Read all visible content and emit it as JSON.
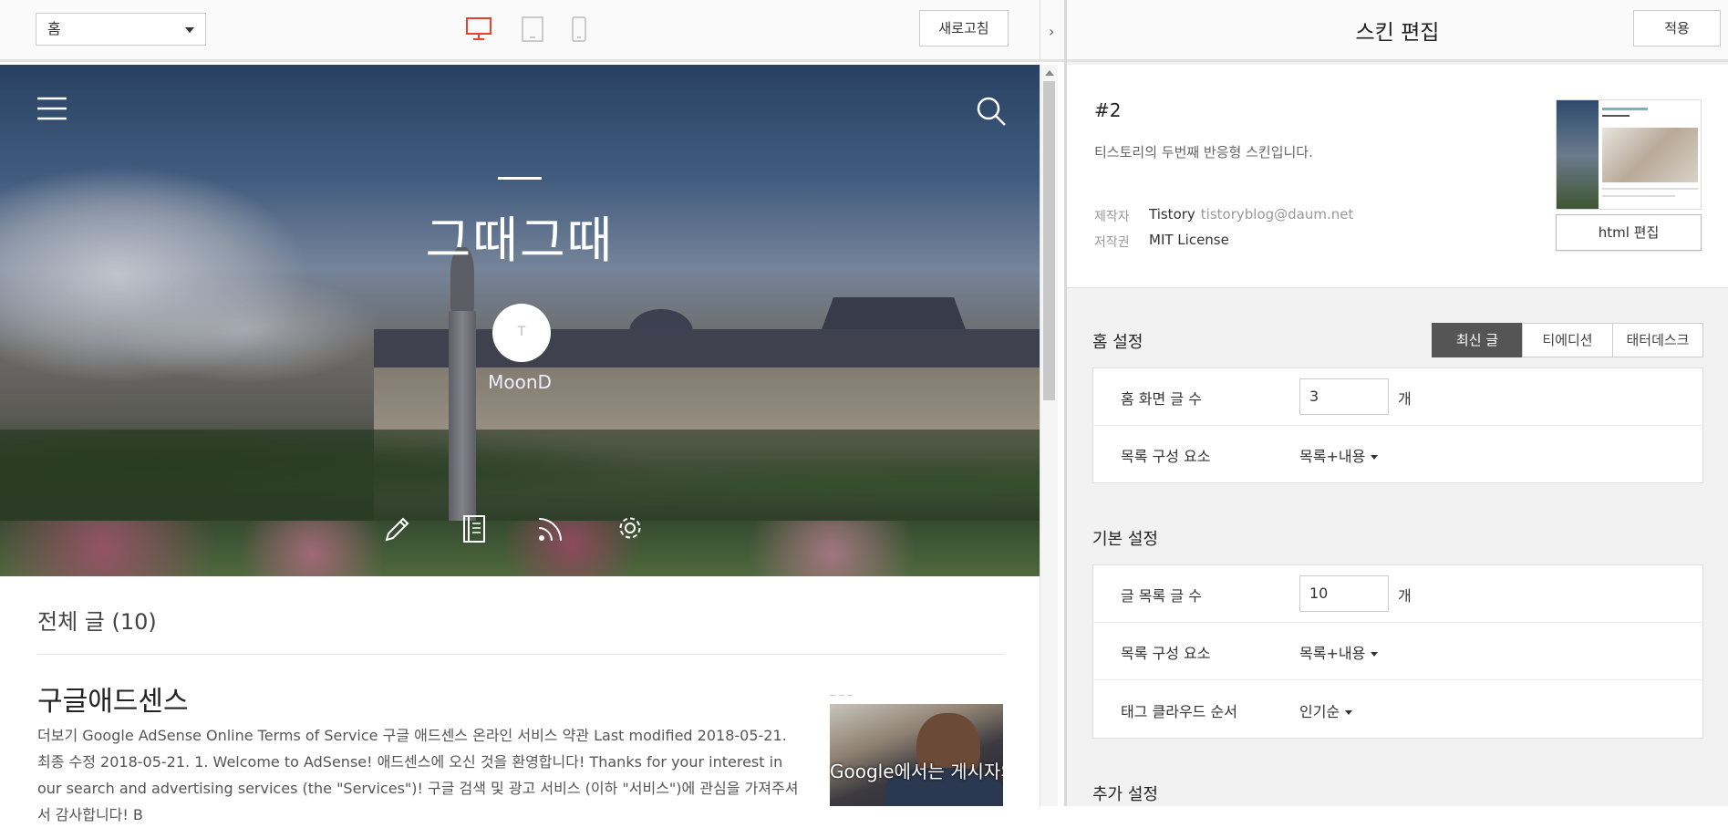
{
  "toolbar": {
    "page_select_value": "홈",
    "refresh_label": "새로고침",
    "accent_color": "#e8412c"
  },
  "preview": {
    "blog_title": "그때그때",
    "profile_name": "MoonD",
    "profile_initial": "T",
    "list_title": "전체 글 (10)",
    "post": {
      "title": "구글애드센스",
      "excerpt": "더보기 Google AdSense Online Terms of Service 구글 애드센스 온라인 서비스 약관 Last modified 2018-05-21. 최종 수정 2018-05-21. 1. Welcome to AdSense! 애드센스에 오신 것을 환영합니다! Thanks for your interest in our search and advertising services (the \"Services\")! 구글 검색 및 광고 서비스 (이하 \"서비스\")에 관심을 가져주셔서 감사합니다! B",
      "thumb_text": "Google에서는 게시자의 콘텐츠를 소중하게"
    },
    "icons": [
      "menu-icon",
      "search-icon",
      "write-icon",
      "guestbook-icon",
      "rss-icon",
      "settings-icon"
    ]
  },
  "panel": {
    "title": "스킨 편집",
    "apply_label": "적용",
    "skin": {
      "name": "#2",
      "description": "티스토리의 두번째 반응형 스킨입니다.",
      "author_label": "제작자",
      "author": "Tistory",
      "author_email": "tistoryblog@daum.net",
      "license_label": "저작권",
      "license": "MIT License",
      "html_edit_label": "html 편집"
    },
    "home": {
      "title": "홈 설정",
      "tabs": [
        "최신 글",
        "티에디션",
        "태터데스크"
      ],
      "active_tab": "최신 글",
      "rows": {
        "count_label": "홈 화면 글 수",
        "count_value": "3",
        "unit": "개",
        "elements_label": "목록 구성 요소",
        "elements_value": "목록+내용"
      }
    },
    "basic": {
      "title": "기본 설정",
      "rows": {
        "count_label": "글 목록 글 수",
        "count_value": "10",
        "unit": "개",
        "elements_label": "목록 구성 요소",
        "elements_value": "목록+내용",
        "tag_label": "태그 클라우드 순서",
        "tag_value": "인기순"
      }
    },
    "extra": {
      "title": "추가 설정"
    }
  }
}
